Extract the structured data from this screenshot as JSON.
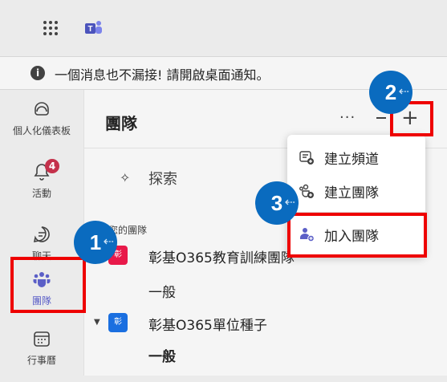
{
  "notification": {
    "text": "一個消息也不漏接! 請開啟桌面通知。"
  },
  "rail": {
    "items": [
      {
        "label": "個人化儀表板"
      },
      {
        "label": "活動",
        "badge": "4"
      },
      {
        "label": "聊天"
      },
      {
        "label": "團隊"
      },
      {
        "label": "行事曆"
      }
    ]
  },
  "panel": {
    "title": "團隊",
    "more": "···",
    "explore": "探索",
    "section_label": "您的團隊",
    "teams": [
      {
        "name": "彰基O365教育訓練團隊",
        "tile": "彰",
        "color": "#e8194a",
        "channel": "一般"
      },
      {
        "name": "彰基O365單位種子",
        "tile": "彰",
        "color": "#1a6fe0",
        "channel": "一般"
      }
    ]
  },
  "menu": {
    "items": [
      {
        "label": "建立頻道"
      },
      {
        "label": "建立團隊"
      },
      {
        "label": "加入團隊"
      }
    ]
  },
  "callouts": [
    "1",
    "2",
    "3"
  ],
  "colors": {
    "accent": "#5b5fc7",
    "callout": "#0a6bbf",
    "highlight": "#ee0000"
  }
}
